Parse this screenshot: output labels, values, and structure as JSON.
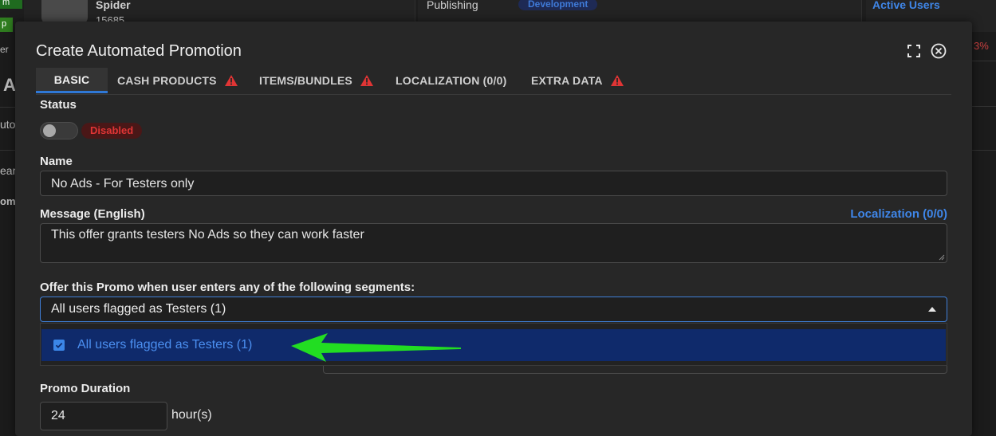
{
  "background": {
    "card_name": "Spider",
    "card_id": "15685",
    "publishing_label": "Publishing",
    "env_badge": "Development",
    "active_users_label": "Active Users",
    "percent_fragment": "3%",
    "side_fragments": [
      "m",
      "p",
      "er",
      "A",
      "uto",
      "ear",
      "omo"
    ]
  },
  "modal": {
    "title": "Create Automated Promotion",
    "tabs": [
      {
        "label": "BASIC",
        "warning": false,
        "active": true
      },
      {
        "label": "CASH PRODUCTS",
        "warning": true,
        "active": false
      },
      {
        "label": "ITEMS/BUNDLES",
        "warning": true,
        "active": false
      },
      {
        "label": "LOCALIZATION (0/0)",
        "warning": false,
        "active": false
      },
      {
        "label": "EXTRA DATA",
        "warning": true,
        "active": false
      }
    ],
    "status": {
      "label": "Status",
      "state": "Disabled"
    },
    "name": {
      "label": "Name",
      "value": "No Ads - For Testers only"
    },
    "message": {
      "label": "Message (English)",
      "localization_link": "Localization (0/0)",
      "value": "This offer grants testers No Ads so they can work faster"
    },
    "segments": {
      "label": "Offer this Promo when user enters any of the following segments:",
      "selected": "All users flagged as Testers (1)",
      "options": [
        {
          "label": "All users flagged as Testers (1)",
          "checked": true
        }
      ]
    },
    "duration": {
      "label": "Promo Duration",
      "value": "24",
      "unit": "hour(s)"
    }
  },
  "colors": {
    "accent": "#2f78d6",
    "warning": "#e03535",
    "annotation_arrow": "#22dd22"
  }
}
